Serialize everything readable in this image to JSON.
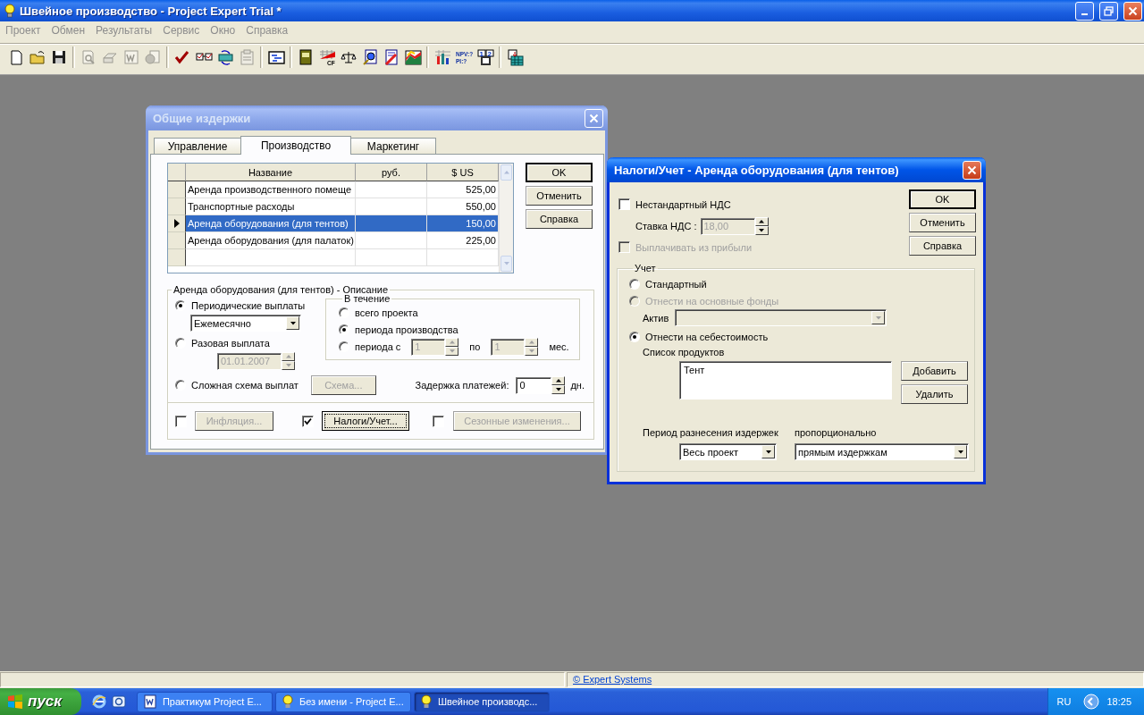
{
  "window": {
    "title": "Швейное производство - Project Expert Trial *"
  },
  "menu": [
    "Проект",
    "Обмен",
    "Результаты",
    "Сервис",
    "Окно",
    "Справка"
  ],
  "toolbar": [
    {
      "kind": "new",
      "disabled": false
    },
    {
      "kind": "open",
      "disabled": false
    },
    {
      "kind": "save",
      "disabled": false
    },
    {
      "kind": "separator"
    },
    {
      "kind": "preview",
      "disabled": true
    },
    {
      "kind": "print",
      "disabled": true
    },
    {
      "kind": "word",
      "disabled": true
    },
    {
      "kind": "export",
      "disabled": true
    },
    {
      "kind": "separator"
    },
    {
      "kind": "check",
      "disabled": false
    },
    {
      "kind": "compare",
      "disabled": false
    },
    {
      "kind": "exchange",
      "disabled": false
    },
    {
      "kind": "clipboard",
      "disabled": true
    },
    {
      "kind": "separator"
    },
    {
      "kind": "schedule",
      "disabled": false
    },
    {
      "kind": "separator"
    },
    {
      "kind": "book",
      "disabled": false
    },
    {
      "kind": "cashflow",
      "disabled": false,
      "labels": [
        "CF"
      ]
    },
    {
      "kind": "scales",
      "disabled": false
    },
    {
      "kind": "globe",
      "disabled": false
    },
    {
      "kind": "pencil",
      "disabled": false
    },
    {
      "kind": "area",
      "disabled": false
    },
    {
      "kind": "separator"
    },
    {
      "kind": "bars",
      "disabled": false
    },
    {
      "kind": "npv",
      "disabled": false,
      "labels": [
        "NPV:?",
        "PI:?"
      ]
    },
    {
      "kind": "grid",
      "disabled": false,
      "labels": [
        "1",
        "2"
      ]
    },
    {
      "kind": "separator"
    },
    {
      "kind": "report",
      "disabled": false
    }
  ],
  "costs_dialog": {
    "title": "Общие издержки",
    "active": false,
    "tabs": [
      {
        "label": "Управление",
        "selected": false
      },
      {
        "label": "Производство",
        "selected": true
      },
      {
        "label": "Маркетинг",
        "selected": false
      }
    ],
    "table": {
      "columns": [
        "Название",
        "руб.",
        "$ US"
      ],
      "rows": [
        {
          "cells": [
            "Аренда производственного помеще",
            "",
            "525,00"
          ],
          "selected": false,
          "current": false
        },
        {
          "cells": [
            "Транспортные расходы",
            "",
            "550,00"
          ],
          "selected": false,
          "current": false
        },
        {
          "cells": [
            "Аренда оборудования (для тентов)",
            "",
            "150,00"
          ],
          "selected": true,
          "current": true
        },
        {
          "cells": [
            "Аренда оборудования (для палаток)",
            "",
            "225,00"
          ],
          "selected": false,
          "current": false
        }
      ]
    },
    "buttons": [
      {
        "label": "OK",
        "default": true
      },
      {
        "label": "Отменить",
        "default": false
      },
      {
        "label": "Справка",
        "default": false
      }
    ],
    "description": {
      "title": "Аренда оборудования (для тентов) - Описание",
      "periodic": {
        "label": "Периодические выплаты",
        "selected": true,
        "frequency": "Ежемесячно"
      },
      "single": {
        "label": "Разовая выплата",
        "selected": false,
        "date": "01.01.2007",
        "disabled": true
      },
      "complex": {
        "label": "Сложная схема выплат",
        "selected": false,
        "button": "Схема...",
        "disabled": true
      },
      "during": {
        "title": "В течение",
        "options": [
          {
            "label": "всего проекта",
            "selected": false
          },
          {
            "label": "периода производства",
            "selected": true
          },
          {
            "label": "периода с",
            "selected": false
          }
        ],
        "from": "1",
        "to_label": "по",
        "to": "1",
        "unit": "мес.",
        "disabled": true
      },
      "delay": {
        "label": "Задержка платежей:",
        "value": "0",
        "unit": "дн."
      }
    },
    "extras": [
      {
        "label": "Инфляция...",
        "checked": false,
        "disabled": true,
        "focused": false
      },
      {
        "label": "Налоги/Учет...",
        "checked": true,
        "disabled": false,
        "focused": true
      },
      {
        "label": "Сезонные изменения...",
        "checked": false,
        "disabled": true,
        "focused": false
      }
    ]
  },
  "tax_dialog": {
    "title": "Налоги/Учет - Аренда оборудования (для тентов)",
    "active": true,
    "nonstandard_vat": {
      "label": "Нестандартный НДС",
      "checked": false
    },
    "vat_rate": {
      "label": "Ставка НДС :",
      "value": "18,00",
      "disabled": true
    },
    "pay_from_profit": {
      "label": "Выплачивать из прибыли",
      "checked": false,
      "disabled": true
    },
    "buttons": [
      {
        "label": "OK",
        "default": true
      },
      {
        "label": "Отменить",
        "default": false
      },
      {
        "label": "Справка",
        "default": false
      }
    ],
    "accounting": {
      "title": "Учет",
      "options": [
        {
          "label": "Стандартный",
          "selected": false,
          "disabled": false
        },
        {
          "label": "Отнести на основные фонды",
          "selected": false,
          "disabled": true
        },
        {
          "label": "Отнести на себестоимость",
          "selected": true,
          "disabled": false
        }
      ],
      "asset": {
        "label": "Актив",
        "disabled": true
      },
      "products": {
        "label": "Список продуктов",
        "items": [
          "Тент"
        ],
        "buttons": [
          "Добавить",
          "Удалить"
        ]
      },
      "period": {
        "label": "Период разнесения издержек",
        "value": "Весь проект"
      },
      "proportional": {
        "label": "пропорционально",
        "value": "прямым издержкам"
      }
    }
  },
  "status_bar": {
    "link": "© Expert Systems"
  },
  "taskbar": {
    "start": "пуск",
    "tasks": [
      {
        "label": "Практикум Project E...",
        "kind": "document",
        "selected": false
      },
      {
        "label": "Без имени - Project E...",
        "kind": "app",
        "selected": false
      },
      {
        "label": "Швейное производс...",
        "kind": "app",
        "selected": true
      }
    ],
    "language": "RU",
    "clock": "18:25"
  }
}
